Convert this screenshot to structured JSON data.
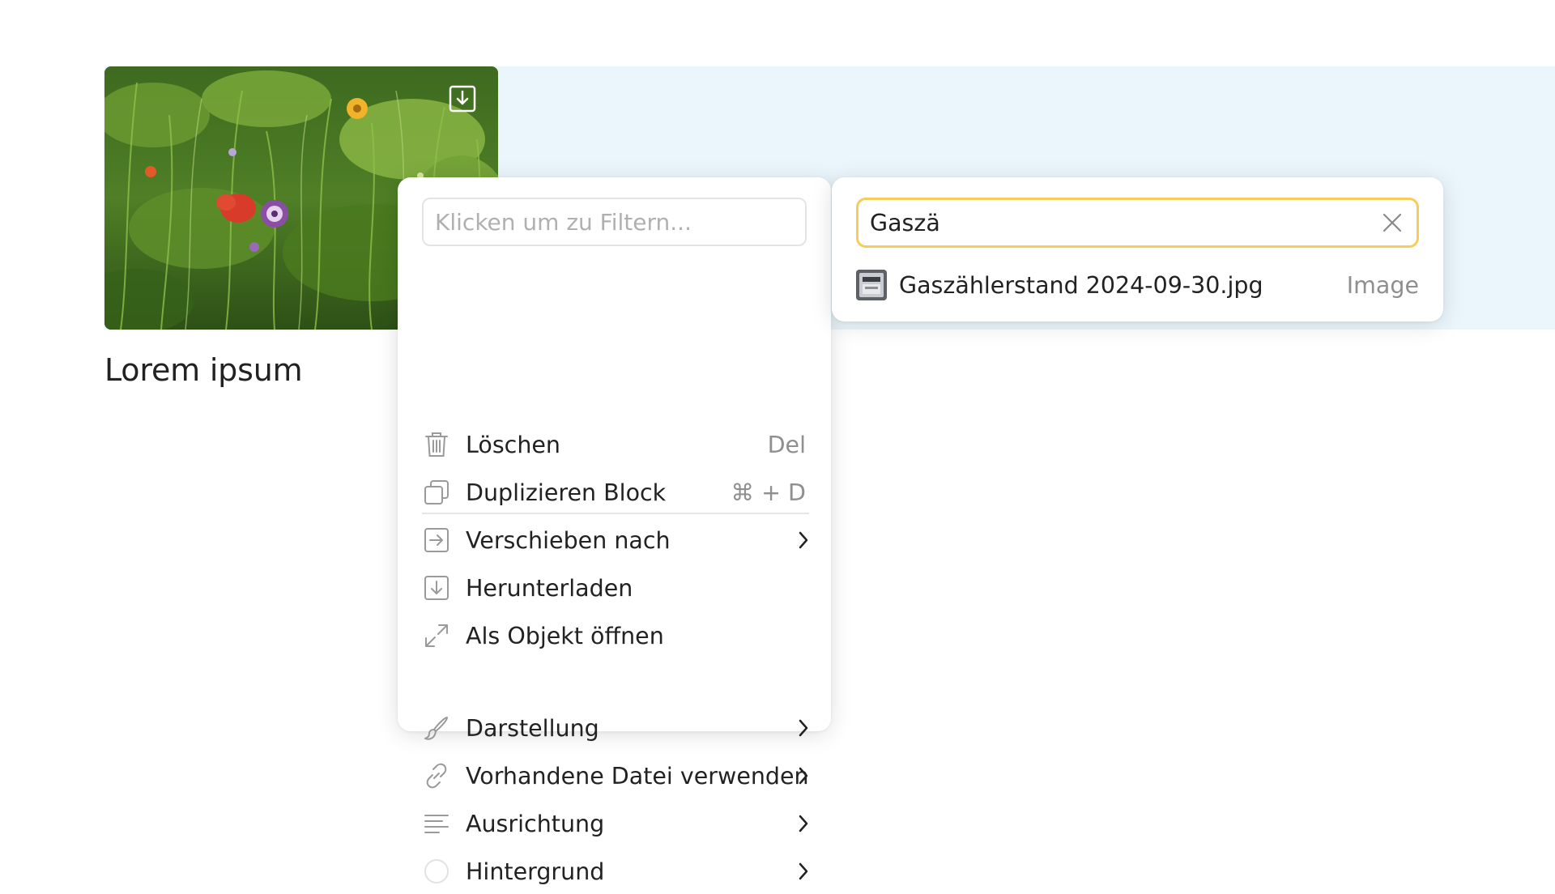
{
  "block": {
    "caption": "Lorem ipsum",
    "image_alt": "Meadow with wildflowers"
  },
  "colors": {
    "block_background": "#ebf6fc",
    "search_focus_border": "#f6cd5a",
    "muted_text": "#8f8f8f",
    "icon_gray": "#9a9a9a"
  },
  "context_menu": {
    "filter_placeholder": "Klicken um zu Filtern...",
    "items": [
      {
        "label": "Löschen",
        "icon": "trash-icon",
        "shortcut": "Del"
      },
      {
        "label": "Duplizieren Block",
        "icon": "duplicate-icon",
        "shortcut": "⌘ + D"
      },
      {
        "label": "Verschieben nach",
        "icon": "move-to-icon",
        "submenu": true
      },
      {
        "label": "Herunterladen",
        "icon": "download-icon"
      },
      {
        "label": "Als Objekt öffnen",
        "icon": "expand-icon"
      },
      {
        "label": "Darstellung",
        "icon": "brush-icon",
        "submenu": true
      },
      {
        "label": "Vorhandene Datei verwenden",
        "icon": "link-icon",
        "submenu": true
      },
      {
        "label": "Ausrichtung",
        "icon": "align-left-icon",
        "submenu": true
      },
      {
        "label": "Hintergrund",
        "icon": "color-circle-icon",
        "submenu": true
      }
    ]
  },
  "file_picker": {
    "search_value": "Gaszä",
    "results": [
      {
        "name": "Gaszählerstand 2024-09-30.jpg",
        "type": "Image",
        "icon": "gas-meter-thumbnail"
      }
    ]
  }
}
